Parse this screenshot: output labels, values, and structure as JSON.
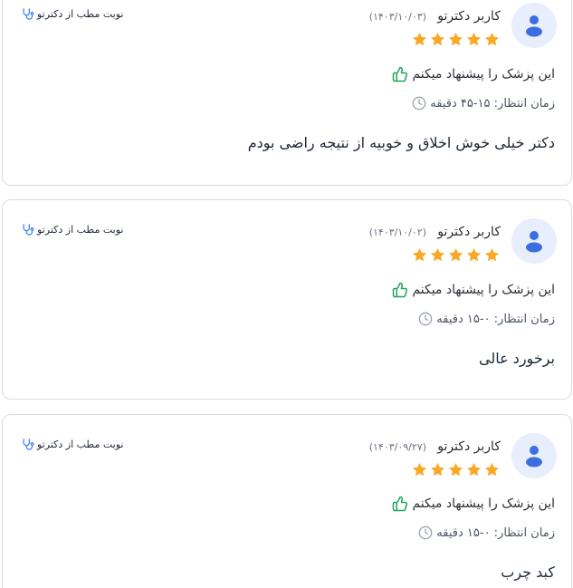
{
  "colors": {
    "star": "#f9a825",
    "thumb": "#22a35a",
    "avatar_bg": "#e8eefb",
    "avatar_fg": "#3b6fe0",
    "stethoscope": "#3b82f6",
    "border": "#d9dce1"
  },
  "icons": {
    "avatar": "user-icon",
    "rating": "star-icon",
    "recommend": "thumbs-up-icon",
    "wait": "clock-icon",
    "booking": "stethoscope-icon"
  },
  "reviews": [
    {
      "username": "کاربر دکترتو",
      "date": "(۱۴۰۳/۱۰/۰۳)",
      "rating": 5,
      "recommend": "این پزشک را پیشنهاد میکنم",
      "wait_time": "زمان انتظار: ۱۵-۴۵ دقیقه",
      "comment": "دکتر خیلی خوش اخلاق و خوبیه از نتیجه راضی بودم",
      "booking": "نوبت مطب از دکترتو"
    },
    {
      "username": "کاربر دکترتو",
      "date": "(۱۴۰۳/۱۰/۰۲)",
      "rating": 5,
      "recommend": "این پزشک را پیشنهاد میکنم",
      "wait_time": "زمان انتظار: ۰-۱۵ دقیقه",
      "comment": "برخورد عالی",
      "booking": "نوبت مطب از دکترتو"
    },
    {
      "username": "کاربر دکترتو",
      "date": "(۱۴۰۳/۰۹/۲۷)",
      "rating": 5,
      "recommend": "این پزشک را پیشنهاد میکنم",
      "wait_time": "زمان انتظار: ۰-۱۵ دقیقه",
      "comment": "کبد چرب",
      "booking": "نوبت مطب از دکترتو"
    }
  ]
}
